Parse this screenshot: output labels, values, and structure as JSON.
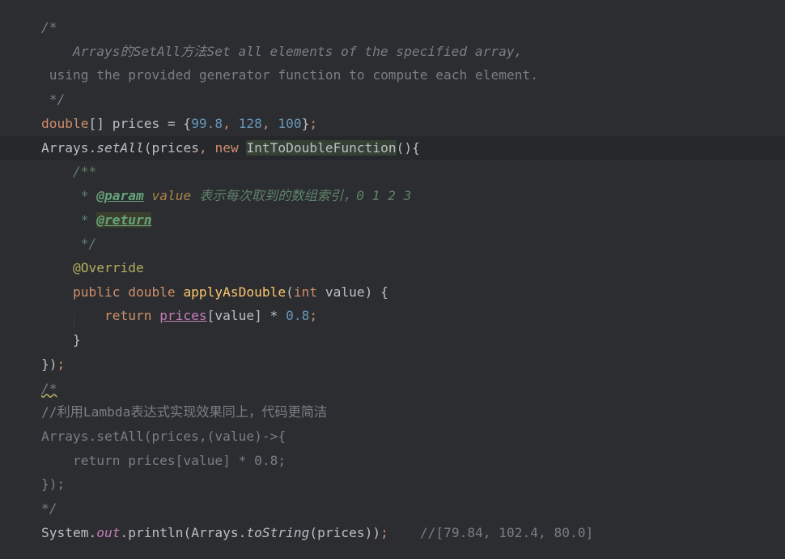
{
  "editor": {
    "lines": [
      {
        "segments": [
          {
            "t": "/*",
            "c": "cm"
          }
        ]
      },
      {
        "segments": [
          {
            "t": "    Arrays的SetAll方法Set all elements of the specified array,",
            "c": "cm"
          }
        ]
      },
      {
        "segments": [
          {
            "t": " using the provided generator function to compute each element.",
            "c": "lc"
          }
        ]
      },
      {
        "segments": [
          {
            "t": " */",
            "c": "cm"
          }
        ]
      },
      {
        "segments": [
          {
            "t": "double",
            "c": "kw"
          },
          {
            "t": "[] prices = {",
            "c": ""
          },
          {
            "t": "99.8",
            "c": "num2"
          },
          {
            "t": ", ",
            "c": "kw"
          },
          {
            "t": "128",
            "c": "num2"
          },
          {
            "t": ", ",
            "c": "kw"
          },
          {
            "t": "100",
            "c": "num2"
          },
          {
            "t": "}",
            "c": ""
          },
          {
            "t": ";",
            "c": "kw"
          }
        ]
      },
      {
        "current": true,
        "segments": [
          {
            "t": "Arrays.",
            "c": ""
          },
          {
            "t": "setAll",
            "c": "it"
          },
          {
            "t": "(prices",
            "c": ""
          },
          {
            "t": ", ",
            "c": "kw"
          },
          {
            "t": "new ",
            "c": "kw"
          },
          {
            "t": "IntToDoubleFunction",
            "c": "hl"
          },
          {
            "t": "(){",
            "c": ""
          }
        ]
      },
      {
        "segments": [
          {
            "t": "    /**",
            "c": "doc"
          }
        ]
      },
      {
        "segments": [
          {
            "t": "     * ",
            "c": "doc"
          },
          {
            "t": "@param",
            "c": "doctag"
          },
          {
            "t": " value",
            "c": "docparam"
          },
          {
            "t": " 表示每次取到的数组索引，0 1 2 3",
            "c": "doc"
          }
        ]
      },
      {
        "segments": [
          {
            "t": "     * ",
            "c": "doc"
          },
          {
            "t": "@return",
            "c": "doctag hl2"
          }
        ]
      },
      {
        "segments": [
          {
            "t": "     */",
            "c": "doc"
          }
        ]
      },
      {
        "segments": [
          {
            "t": "    ",
            "c": ""
          },
          {
            "t": "@Override",
            "c": "ann"
          }
        ]
      },
      {
        "segments": [
          {
            "t": "    public double ",
            "c": "kw"
          },
          {
            "t": "applyAsDouble",
            "c": "fn2"
          },
          {
            "t": "(",
            "c": ""
          },
          {
            "t": "int ",
            "c": "kw"
          },
          {
            "t": "value) {",
            "c": ""
          }
        ]
      },
      {
        "segments": [
          {
            "t": "        return ",
            "c": "kw"
          },
          {
            "t": "prices",
            "c": "field"
          },
          {
            "t": "[value] * ",
            "c": ""
          },
          {
            "t": "0.8",
            "c": "num2"
          },
          {
            "t": ";",
            "c": "kw"
          }
        ]
      },
      {
        "segments": [
          {
            "t": "    }",
            "c": ""
          }
        ]
      },
      {
        "segments": [
          {
            "t": "})",
            "c": ""
          },
          {
            "t": ";",
            "c": "kw"
          }
        ]
      },
      {
        "segments": [
          {
            "t": "/*",
            "c": "cm warn"
          }
        ]
      },
      {
        "segments": [
          {
            "t": "//利用Lambda表达式实现效果同上，代码更简洁",
            "c": "lc"
          }
        ]
      },
      {
        "segments": [
          {
            "t": "Arrays.setAll(prices,(value)->{",
            "c": "lc"
          }
        ]
      },
      {
        "segments": [
          {
            "t": "    return prices[value] * 0.8;",
            "c": "lc"
          }
        ]
      },
      {
        "segments": [
          {
            "t": "});",
            "c": "lc"
          }
        ]
      },
      {
        "segments": [
          {
            "t": "*/",
            "c": "cm"
          }
        ]
      },
      {
        "segments": [
          {
            "t": "System.",
            "c": ""
          },
          {
            "t": "out",
            "c": "static"
          },
          {
            "t": ".println(Arrays.",
            "c": ""
          },
          {
            "t": "toString",
            "c": "it"
          },
          {
            "t": "(prices))",
            "c": ""
          },
          {
            "t": ";",
            "c": "kw"
          },
          {
            "t": "    //[79.84, 102.4, 80.0]",
            "c": "lc"
          }
        ]
      }
    ]
  }
}
